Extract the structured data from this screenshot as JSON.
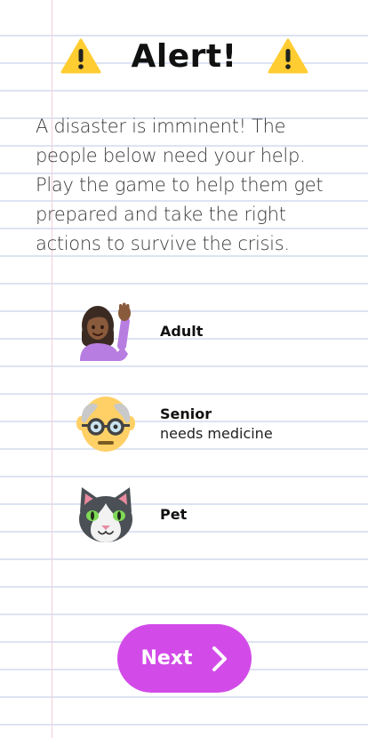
{
  "header": {
    "title": "Alert!",
    "left_icon": "warning-icon",
    "right_icon": "warning-icon"
  },
  "intro_text": "A disaster is imminent! The people below need your help. Play the game to help them get prepared and take the right actions to survive the crisis.",
  "characters": [
    {
      "name": "Adult",
      "note": "",
      "icon": "adult-woman-icon"
    },
    {
      "name": "Senior",
      "note": "needs medicine",
      "icon": "senior-man-icon"
    },
    {
      "name": "Pet",
      "note": "",
      "icon": "cat-icon"
    }
  ],
  "next_button": {
    "label": "Next",
    "icon": "chevron-right-icon",
    "color": "#d24be8"
  },
  "colors": {
    "warning": "#ffcc32",
    "ruled_line": "#dde3f2",
    "margin_line": "#f3cfd8"
  }
}
